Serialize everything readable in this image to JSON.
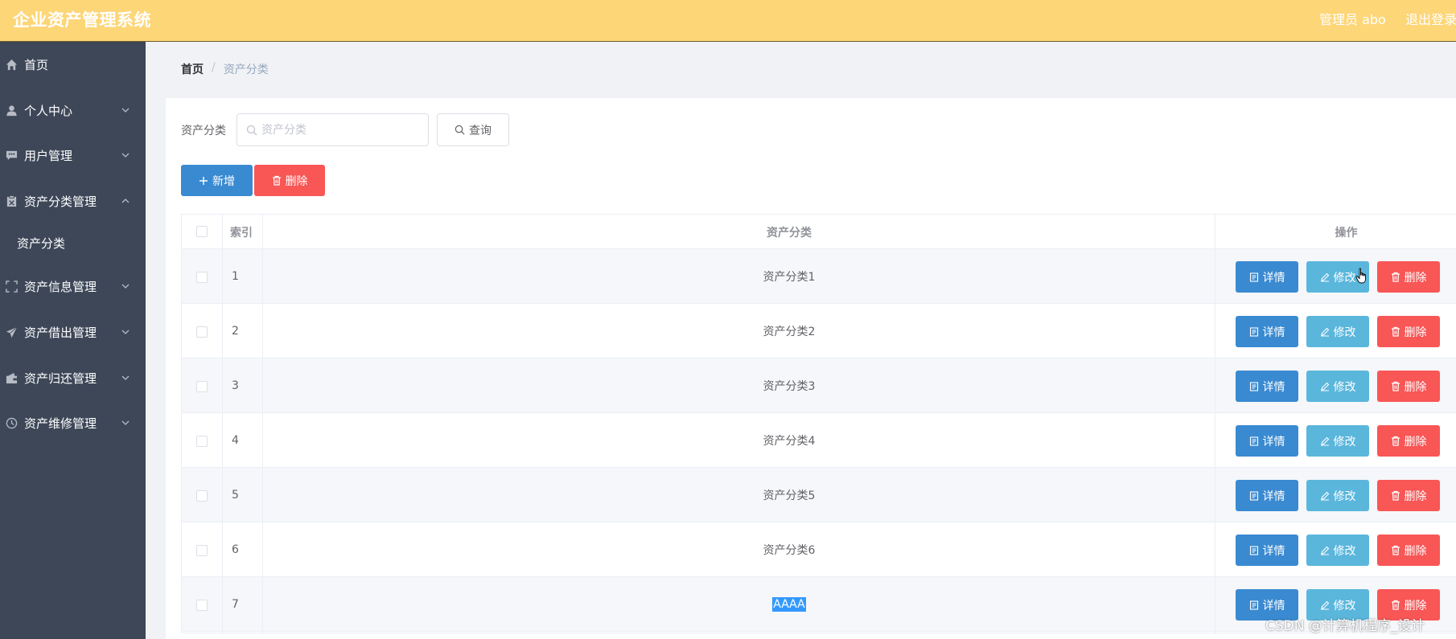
{
  "header": {
    "title": "企业资产管理系统",
    "user": "管理员 abo",
    "logout": "退出登录"
  },
  "sidebar": {
    "items": [
      {
        "label": "首页",
        "icon": "home-icon"
      },
      {
        "label": "个人中心",
        "icon": "user-icon"
      },
      {
        "label": "用户管理",
        "icon": "chat-icon"
      },
      {
        "label": "资产分类管理",
        "icon": "clipboard-icon"
      },
      {
        "label": "资产分类",
        "icon": ""
      },
      {
        "label": "资产信息管理",
        "icon": "fullscreen-icon"
      },
      {
        "label": "资产借出管理",
        "icon": "send-icon"
      },
      {
        "label": "资产归还管理",
        "icon": "wallet-icon"
      },
      {
        "label": "资产维修管理",
        "icon": "clock-icon"
      }
    ]
  },
  "breadcrumb": {
    "home": "首页",
    "separator": "/",
    "current": "资产分类"
  },
  "search": {
    "label": "资产分类",
    "value": "",
    "placeholder": "资产分类",
    "query_label": "查询"
  },
  "toolbar": {
    "add_label": "新增",
    "delete_label": "删除"
  },
  "table": {
    "headers": {
      "index": "索引",
      "name": "资产分类",
      "actions": "操作"
    },
    "rows": [
      {
        "index": "1",
        "name": "资产分类1"
      },
      {
        "index": "2",
        "name": "资产分类2"
      },
      {
        "index": "3",
        "name": "资产分类3"
      },
      {
        "index": "4",
        "name": "资产分类4"
      },
      {
        "index": "5",
        "name": "资产分类5"
      },
      {
        "index": "6",
        "name": "资产分类6"
      },
      {
        "index": "7",
        "name": "AAAA"
      }
    ],
    "actions": {
      "detail": "详情",
      "edit": "修改",
      "delete": "删除"
    }
  },
  "watermark": "CSDN @计算机程序_设计",
  "colors": {
    "header_bg": "#fdd678",
    "sidebar_bg": "#3d4758",
    "primary": "#3a8ad1",
    "info": "#5bb6dc",
    "danger": "#f95656"
  }
}
